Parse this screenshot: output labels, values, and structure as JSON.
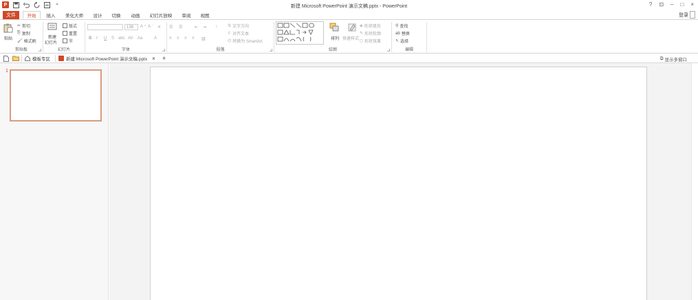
{
  "window": {
    "title": "新建 Microsoft PowerPoint 演示文稿.pptx - PowerPoint",
    "controls": [
      "?",
      "⊡",
      "–",
      "□",
      "×"
    ]
  },
  "qat": {
    "logo": "P",
    "save": "💾",
    "undo": "↶",
    "redo": "↻",
    "custom": "⊞"
  },
  "tabs": {
    "file": "文件",
    "home": "开始",
    "insert": "插入",
    "beautify": "美化大师",
    "design": "设计",
    "transitions": "切换",
    "animations": "动画",
    "slideshow": "幻灯片放映",
    "review": "审阅",
    "view": "视图",
    "login": "登录"
  },
  "ribbon": {
    "clipboard": {
      "label": "剪贴板",
      "paste": "粘贴",
      "cut": "剪切",
      "copy": "复制",
      "format_painter": "格式刷"
    },
    "slides": {
      "label": "幻灯片",
      "new_slide_line1": "新建",
      "new_slide_line2": "幻灯片",
      "layout": "版式",
      "reset": "重置",
      "section": "节"
    },
    "font": {
      "label": "字体",
      "size": "138"
    },
    "paragraph": {
      "label": "段落",
      "text_direction": "文字方向",
      "align_text": "对齐文本",
      "convert_smartart": "转换为 SmartArt"
    },
    "drawing": {
      "label": "绘图",
      "arrange": "排列",
      "quick_styles": "快速样式",
      "shape_fill": "形状填充",
      "shape_outline": "形状轮廓",
      "shape_effects": "形状效果"
    },
    "editing": {
      "label": "编辑",
      "find": "查找",
      "replace": "替换",
      "select": "选择"
    }
  },
  "doc_tabs": {
    "templates": "模板专区",
    "doc_name": "新建 Microsoft PowerPoint 演示文稿.pptx",
    "close": "×",
    "add": "+",
    "multi_window": "显示多窗口"
  },
  "slides_panel": {
    "slide_number": "1"
  },
  "colors": {
    "accent": "#d24726",
    "thumb_border": "#d99a80"
  }
}
